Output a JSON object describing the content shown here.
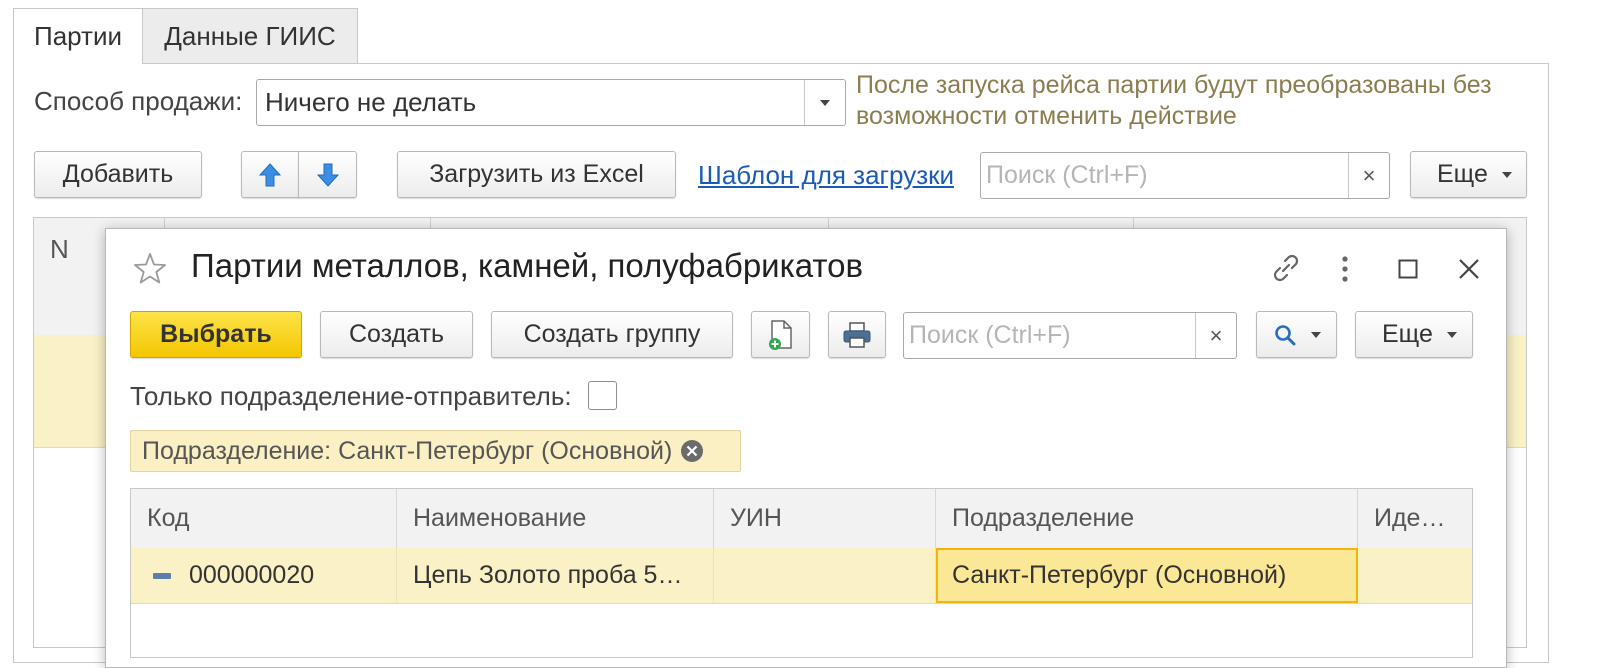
{
  "tabs": [
    {
      "label": "Партии"
    },
    {
      "label": "Данные ГИИС"
    }
  ],
  "sale_method": {
    "label": "Способ продажи:",
    "value": "Ничего не делать",
    "hint": "После запуска рейса партии будут преобразованы без возможности отменить действие"
  },
  "toolbar": {
    "add_label": "Добавить",
    "load_excel_label": "Загрузить из Excel",
    "template_link": "Шаблон для загрузки",
    "search_placeholder": "Поиск (Ctrl+F)",
    "clear_symbol": "×",
    "more_label": "Еще"
  },
  "background_table": {
    "first_header": "N"
  },
  "dialog": {
    "title": "Партии металлов, камней, полуфабрикатов",
    "buttons": {
      "select": "Выбрать",
      "create": "Создать",
      "create_group": "Создать группу",
      "search_placeholder": "Поиск (Ctrl+F)",
      "clear_symbol": "×",
      "more": "Еще"
    },
    "only_sender": {
      "label": "Только подразделение-отправитель:",
      "checked": false
    },
    "filter_chip": "Подразделение: Санкт-Петербург (Основной)",
    "columns": [
      "Код",
      "Наименование",
      "УИН",
      "Подразделение",
      "Иде…"
    ],
    "rows": [
      {
        "code": "000000020",
        "name": "Цепь Золото проба 5…",
        "uin": "",
        "division": "Санкт-Петербург (Основной)",
        "ident": ""
      }
    ]
  },
  "colors": {
    "accent_yellow": "#f5c800",
    "selected_row": "#fbf1c6",
    "hint_text": "#8b7d50",
    "link": "#1a5bb5"
  }
}
